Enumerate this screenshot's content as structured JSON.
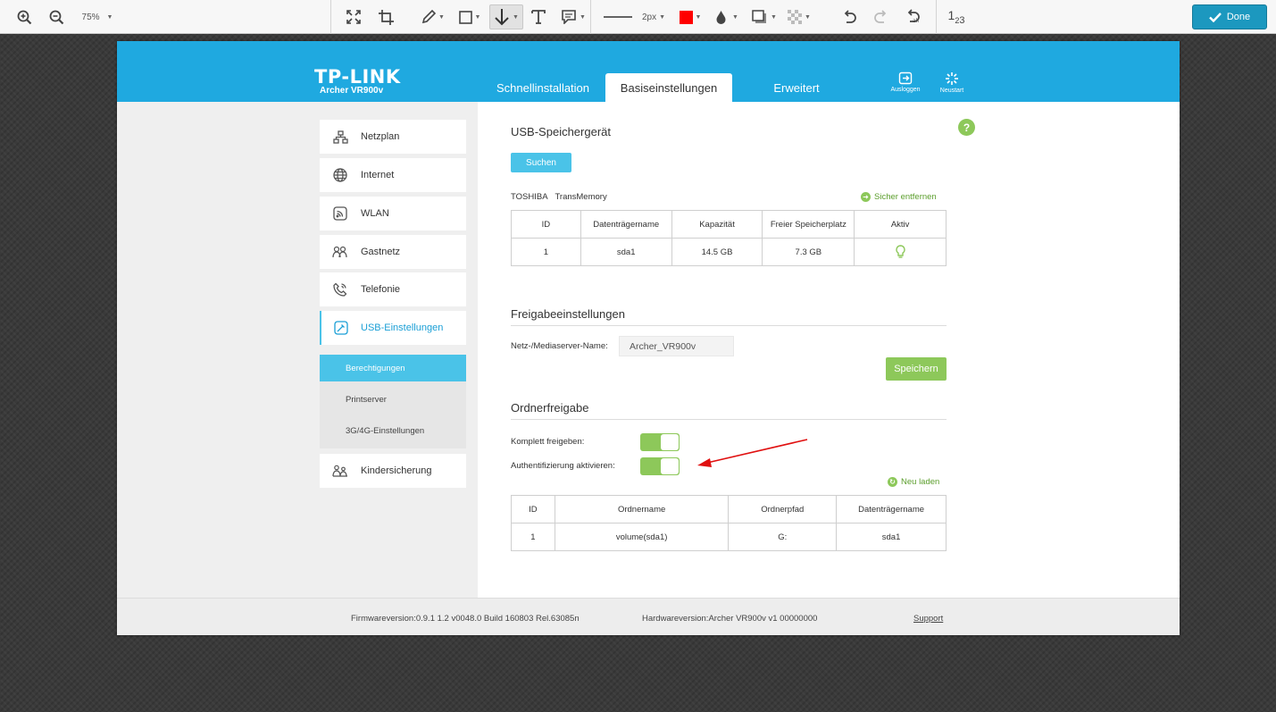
{
  "toolbar": {
    "zoom_label": "75%",
    "stroke_width_label": "2px",
    "counter_label": "1",
    "counter_sub": "2",
    "counter_sub2": "3",
    "done_label": "Done",
    "accent_color": "#1c98bf",
    "fill_color": "#ff0000"
  },
  "header": {
    "logo": "TP-LINK",
    "model": "Archer VR900v",
    "tabs": [
      "Schnellinstallation",
      "Basiseinstellungen",
      "Erweitert"
    ],
    "logout_label": "Ausloggen",
    "restart_label": "Neustart",
    "brand_color": "#1fa9e0"
  },
  "sidebar": {
    "items": [
      {
        "label": "Netzplan",
        "icon": "network-icon"
      },
      {
        "label": "Internet",
        "icon": "globe-icon"
      },
      {
        "label": "WLAN",
        "icon": "wifi-icon"
      },
      {
        "label": "Gastnetz",
        "icon": "guest-icon"
      },
      {
        "label": "Telefonie",
        "icon": "phone-icon"
      },
      {
        "label": "USB-Einstellungen",
        "icon": "usb-icon"
      }
    ],
    "subitems": [
      "Berechtigungen",
      "Printserver",
      "3G/4G-Einstellungen"
    ],
    "last_item": "Kindersicherung"
  },
  "usb": {
    "title": "USB-Speichergerät",
    "search_button": "Suchen",
    "device_vendor": "TOSHIBA",
    "device_name": "TransMemory",
    "remove_link": "Sicher entfernen",
    "table_headers": [
      "ID",
      "Datenträgername",
      "Kapazität",
      "Freier Speicherplatz",
      "Aktiv"
    ],
    "table_rows": [
      [
        "1",
        "sda1",
        "14.5 GB",
        "7.3 GB"
      ]
    ]
  },
  "share": {
    "title": "Freigabeeinstellungen",
    "server_label": "Netz-/Mediaserver-Name:",
    "server_value": "Archer_VR900v",
    "save_button": "Speichern"
  },
  "folder": {
    "title": "Ordnerfreigabe",
    "share_all_label": "Komplett freigeben:",
    "share_all_enabled": true,
    "auth_label": "Authentifizierung aktivieren:",
    "auth_enabled": true,
    "reload_link": "Neu laden",
    "table_headers": [
      "ID",
      "Ordnername",
      "Ordnerpfad",
      "Datenträgername"
    ],
    "table_rows": [
      [
        "1",
        "volume(sda1)",
        "G:",
        "sda1"
      ]
    ]
  },
  "footer": {
    "firmware": "Firmwareversion:0.9.1 1.2 v0048.0 Build 160803 Rel.63085n",
    "hardware": "Hardwareversion:Archer VR900v v1 00000000",
    "support": "Support"
  },
  "annotation_color": "#e01010"
}
